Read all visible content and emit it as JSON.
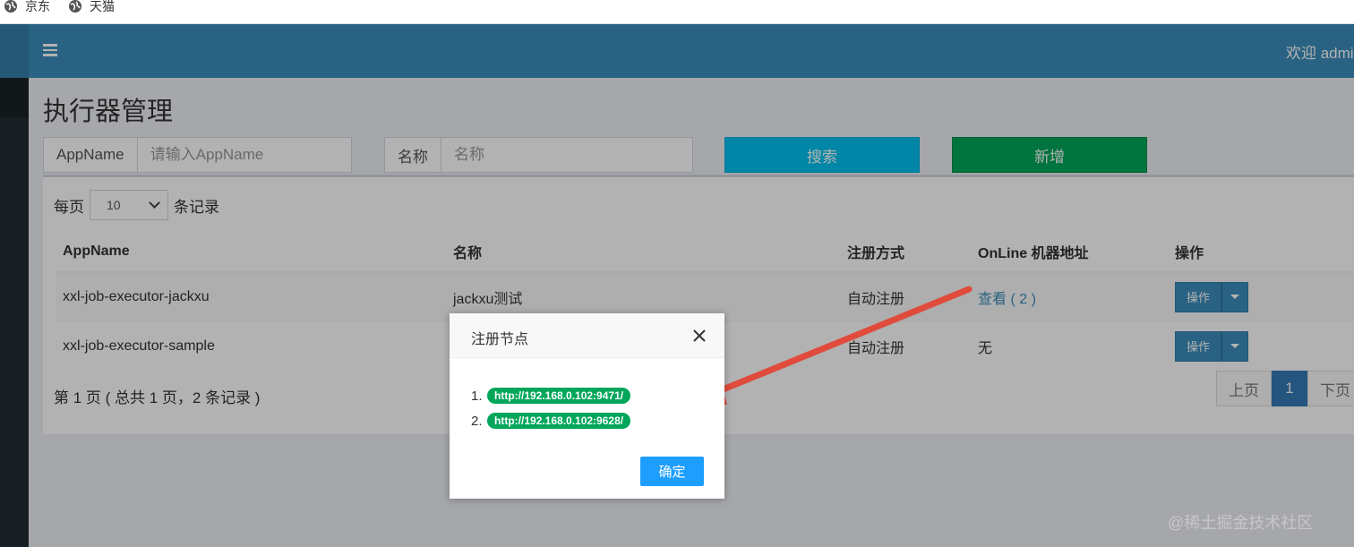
{
  "bookmarks": [
    {
      "label": "京东",
      "icon": "globe-icon"
    },
    {
      "label": "天猫",
      "icon": "globe-icon"
    }
  ],
  "header": {
    "welcome": "欢迎 admin"
  },
  "page": {
    "title": "执行器管理"
  },
  "search": {
    "appname_label": "AppName",
    "appname_placeholder": "请输入AppName",
    "name_label": "名称",
    "name_placeholder": "名称",
    "search_button": "搜索",
    "add_button": "新增"
  },
  "table": {
    "length_prefix": "每页",
    "length_value": "10",
    "length_suffix": "条记录",
    "columns": [
      "AppName",
      "名称",
      "注册方式",
      "OnLine 机器地址",
      "操作"
    ],
    "rows": [
      {
        "appname": "xxl-job-executor-jackxu",
        "name": "jackxu测试",
        "register": "自动注册",
        "online": "查看 ( 2 )",
        "action": "操作"
      },
      {
        "appname": "xxl-job-executor-sample",
        "name": "",
        "register": "自动注册",
        "online": "无",
        "action": "操作"
      }
    ],
    "info": "第 1 页 ( 总共 1 页，2 条记录 )",
    "pager": {
      "prev": "上页",
      "current": "1",
      "next": "下页"
    }
  },
  "modal": {
    "title": "注册节点",
    "nodes": [
      {
        "index": "1.",
        "url": "http://192.168.0.102:9471/"
      },
      {
        "index": "2.",
        "url": "http://192.168.0.102:9628/"
      }
    ],
    "confirm": "确定"
  },
  "watermark": "@稀土掘金技术社区",
  "colors": {
    "header": "#3c8dbc",
    "sidebar": "#222d32",
    "search_button": "#00c0ef",
    "add_button": "#00a65a",
    "badge": "#00a65a",
    "confirm": "#1e9fff",
    "arrow": "#e04b3c"
  }
}
